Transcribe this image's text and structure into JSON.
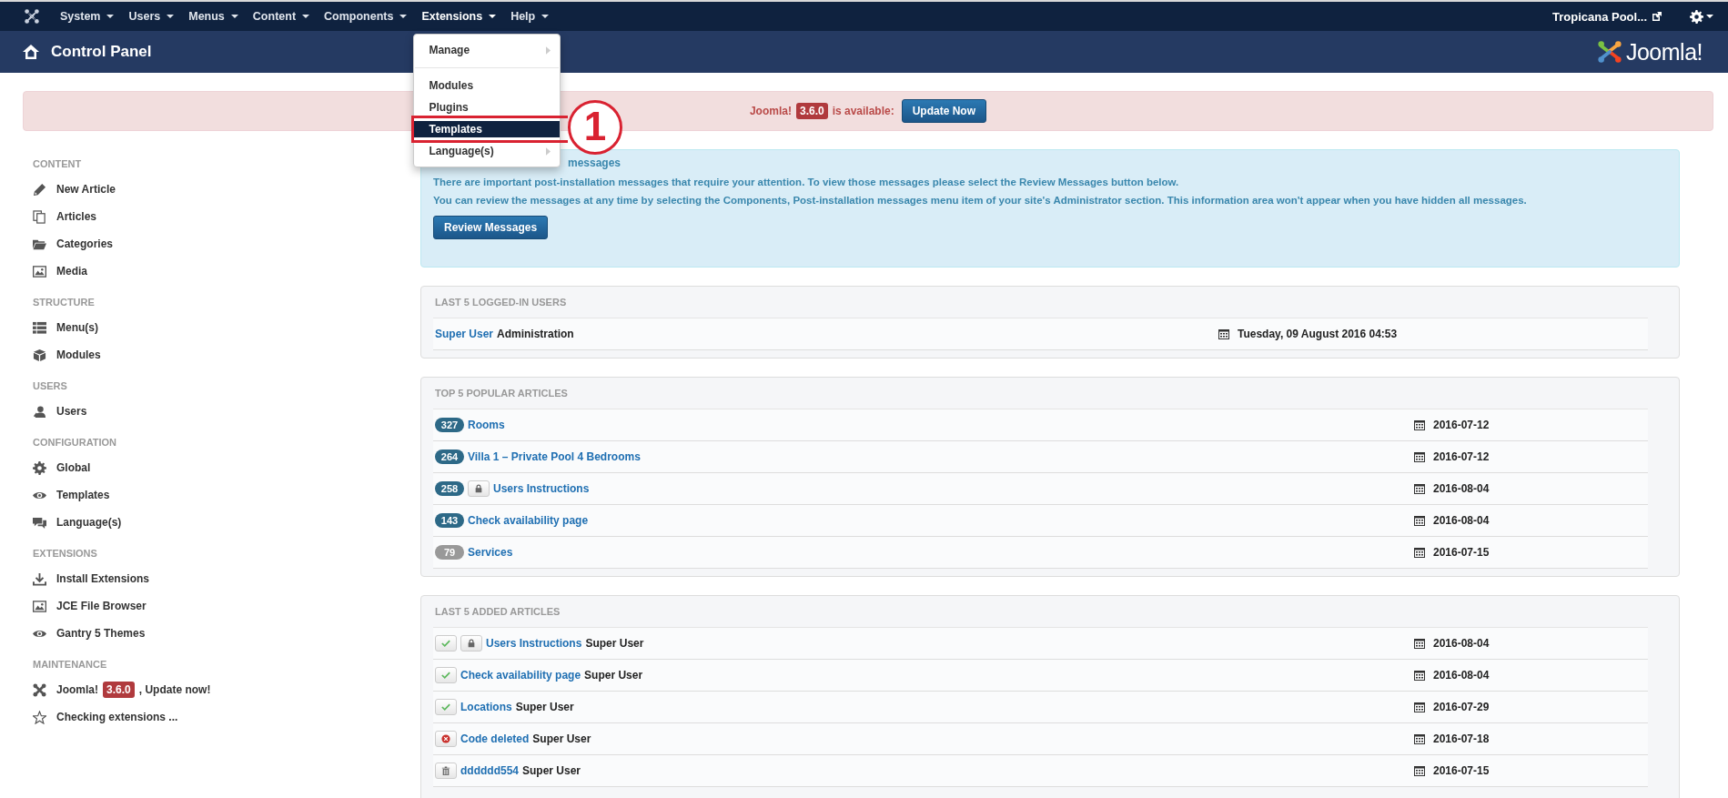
{
  "navbar": {
    "menus": [
      {
        "label": "System",
        "open": false
      },
      {
        "label": "Users",
        "open": false
      },
      {
        "label": "Menus",
        "open": false
      },
      {
        "label": "Content",
        "open": false
      },
      {
        "label": "Components",
        "open": false
      },
      {
        "label": "Extensions",
        "open": true
      },
      {
        "label": "Help",
        "open": false
      }
    ],
    "site_link": "Tropicana Pool..."
  },
  "dropdown": {
    "items": [
      {
        "kind": "submenu",
        "label": "Manage",
        "selected": false
      },
      {
        "kind": "divider"
      },
      {
        "kind": "item",
        "label": "Modules",
        "selected": false
      },
      {
        "kind": "item",
        "label": "Plugins",
        "selected": false
      },
      {
        "kind": "item",
        "label": "Templates",
        "selected": true
      },
      {
        "kind": "submenu",
        "label": "Language(s)",
        "selected": false
      }
    ]
  },
  "annotation": {
    "label": "1"
  },
  "header": {
    "title": "Control Panel",
    "logo_text": "Joomla!"
  },
  "update_alert": {
    "prefix": "Joomla!",
    "version": "3.6.0",
    "suffix": "is available:",
    "button": "Update Now"
  },
  "sidebar": [
    {
      "heading": "CONTENT",
      "items": [
        {
          "label": "New Article"
        },
        {
          "label": "Articles"
        },
        {
          "label": "Categories"
        },
        {
          "label": "Media"
        }
      ]
    },
    {
      "heading": "STRUCTURE",
      "items": [
        {
          "label": "Menu(s)"
        },
        {
          "label": "Modules"
        }
      ]
    },
    {
      "heading": "USERS",
      "items": [
        {
          "label": "Users"
        }
      ]
    },
    {
      "heading": "CONFIGURATION",
      "items": [
        {
          "label": "Global"
        },
        {
          "label": "Templates"
        },
        {
          "label": "Language(s)"
        }
      ]
    },
    {
      "heading": "EXTENSIONS",
      "items": [
        {
          "label": "Install Extensions"
        },
        {
          "label": "JCE File Browser"
        },
        {
          "label": "Gantry 5 Themes"
        }
      ]
    },
    {
      "heading": "MAINTENANCE",
      "items": [
        {
          "label": "Joomla!",
          "badge": "3.6.0",
          "suffix": ", Update now!"
        },
        {
          "label": "Checking extensions ..."
        }
      ]
    }
  ],
  "post_install": {
    "title": "messages",
    "paragraphs": [
      "There are important post-installation messages that require your attention. To view those messages please select the Review Messages button below.",
      "You can review the messages at any time by selecting the Components, Post-installation messages menu item of your site's Administrator section. This information area won't appear when you have hidden all messages."
    ],
    "button": "Review Messages"
  },
  "logged_users": {
    "title": "LAST 5 LOGGED-IN USERS",
    "rows": [
      {
        "user": "Super User",
        "role": "Administration",
        "date": "Tuesday, 09 August 2016 04:53"
      }
    ]
  },
  "popular_articles": {
    "title": "TOP 5 POPULAR ARTICLES",
    "rows": [
      {
        "hits": "327",
        "hot": true,
        "locked": false,
        "title": "Rooms",
        "date": "2016-07-12"
      },
      {
        "hits": "264",
        "hot": true,
        "locked": false,
        "title": "Villa 1 – Private Pool 4 Bedrooms",
        "date": "2016-07-12"
      },
      {
        "hits": "258",
        "hot": true,
        "locked": true,
        "title": "Users Instructions",
        "date": "2016-08-04"
      },
      {
        "hits": "143",
        "hot": true,
        "locked": false,
        "title": "Check availability page",
        "date": "2016-08-04"
      },
      {
        "hits": "79",
        "hot": false,
        "locked": false,
        "title": "Services",
        "date": "2016-07-15"
      }
    ]
  },
  "added_articles": {
    "title": "LAST 5 ADDED ARTICLES",
    "rows": [
      {
        "kind": "published",
        "locked": true,
        "title": "Users Instructions",
        "author": "Super User",
        "date": "2016-08-04"
      },
      {
        "kind": "published",
        "locked": false,
        "title": "Check availability page",
        "author": "Super User",
        "date": "2016-08-04"
      },
      {
        "kind": "published",
        "locked": false,
        "title": "Locations",
        "author": "Super User",
        "date": "2016-07-29"
      },
      {
        "kind": "unpublished",
        "locked": false,
        "title": "Code deleted",
        "author": "Super User",
        "date": "2016-07-18"
      },
      {
        "kind": "trashed",
        "locked": false,
        "title": "dddddd554",
        "author": "Super User",
        "date": "2016-07-15"
      }
    ]
  }
}
